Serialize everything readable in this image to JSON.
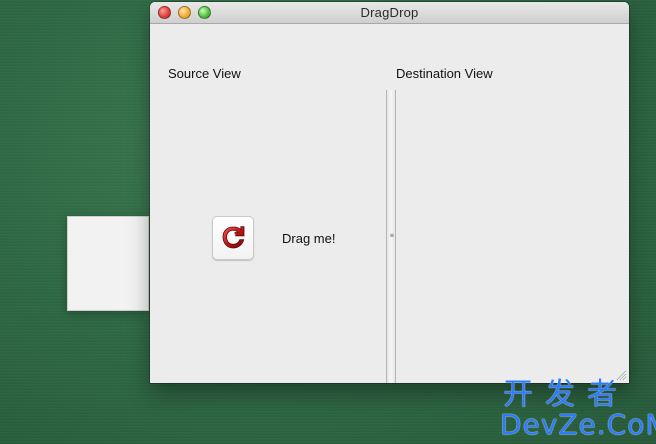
{
  "window": {
    "title": "DragDrop"
  },
  "source": {
    "label": "Source View",
    "drag_label": "Drag me!"
  },
  "destination": {
    "label": "Destination View"
  },
  "watermark": {
    "line1": "开发者",
    "line2": "DevZe.CoM"
  },
  "colors": {
    "desktop_green": "#2f6a45",
    "window_bg": "#ececec",
    "watermark_blue": "#2c7bff"
  },
  "icons": {
    "app_icon": "red-refresh-icon"
  }
}
